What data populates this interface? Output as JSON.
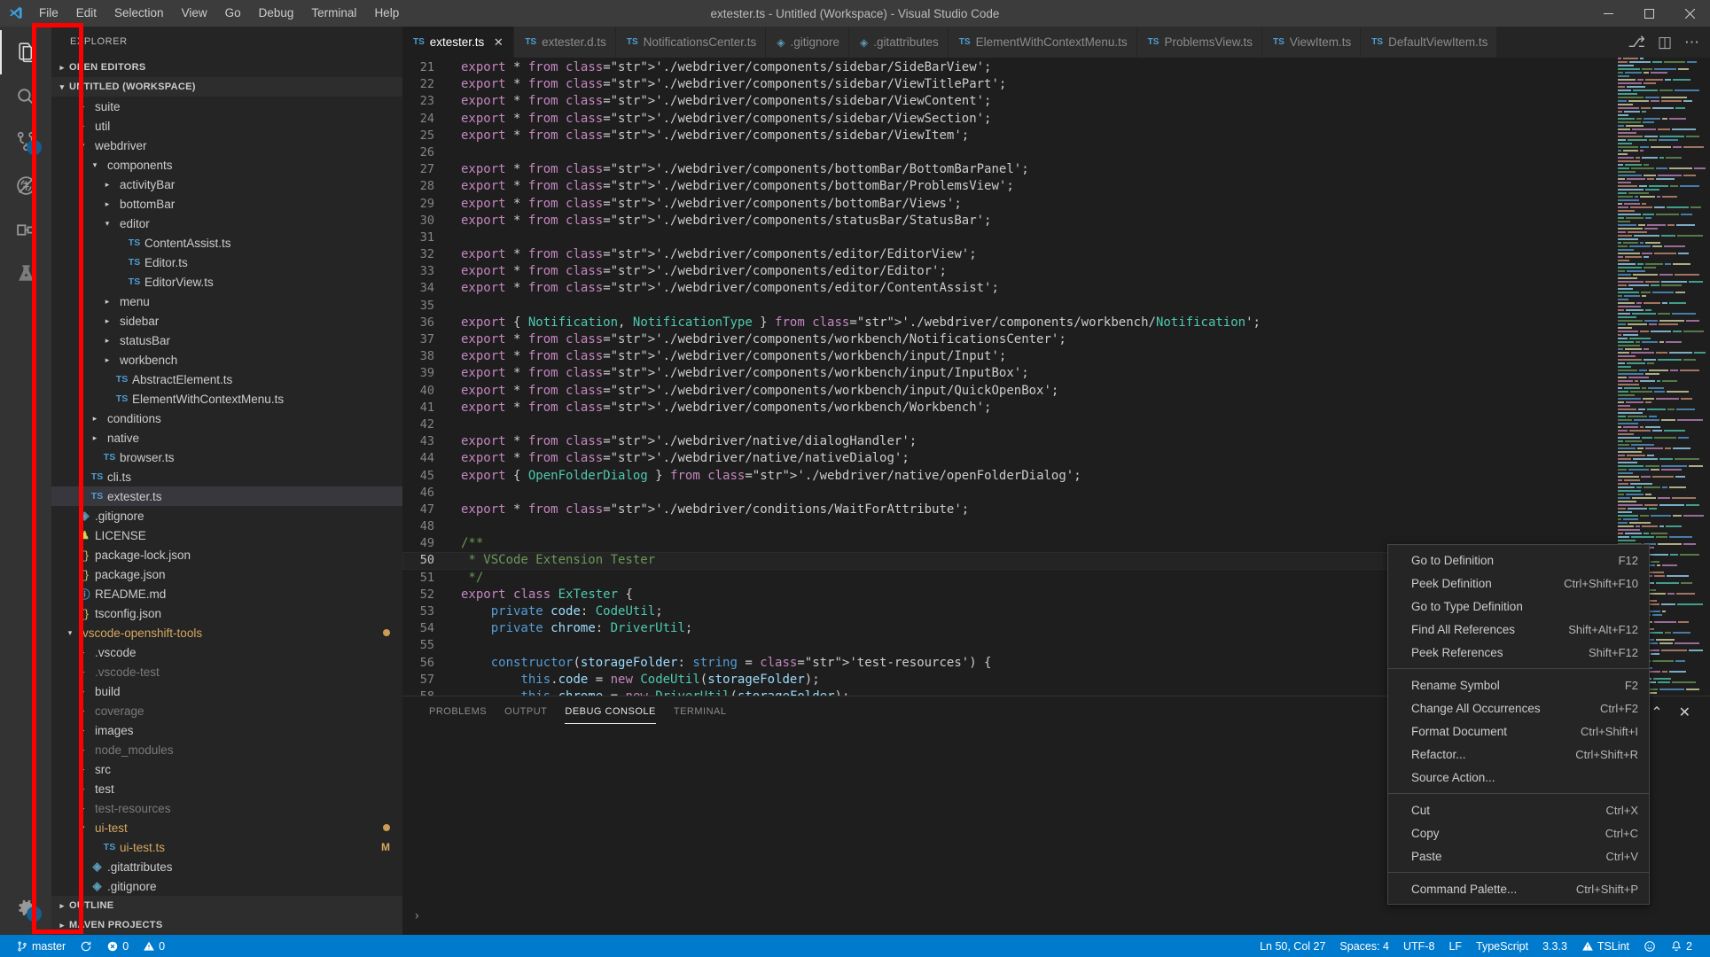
{
  "window": {
    "title": "extester.ts - Untitled (Workspace) - Visual Studio Code",
    "minimize_label": "─",
    "maximize_label": "❐",
    "close_label": "✕"
  },
  "menubar": {
    "items": [
      {
        "label": "File",
        "name": "menu-file"
      },
      {
        "label": "Edit",
        "name": "menu-edit"
      },
      {
        "label": "Selection",
        "name": "menu-selection"
      },
      {
        "label": "View",
        "name": "menu-view"
      },
      {
        "label": "Go",
        "name": "menu-go"
      },
      {
        "label": "Debug",
        "name": "menu-debug"
      },
      {
        "label": "Terminal",
        "name": "menu-terminal"
      },
      {
        "label": "Help",
        "name": "menu-help"
      }
    ]
  },
  "activitybar": {
    "highlight_color": "#ff0000",
    "items": [
      {
        "icon": "files-icon",
        "name": "activity-explorer",
        "active": true,
        "badge": ""
      },
      {
        "icon": "search-icon",
        "name": "activity-search",
        "active": false,
        "badge": ""
      },
      {
        "icon": "source-control-icon",
        "name": "activity-source-control",
        "active": false,
        "badge": "2"
      },
      {
        "icon": "debug-icon",
        "name": "activity-debug",
        "active": false,
        "badge": ""
      },
      {
        "icon": "extensions-icon",
        "name": "activity-extensions",
        "active": false,
        "badge": ""
      },
      {
        "icon": "beaker-icon",
        "name": "activity-test",
        "active": false,
        "badge": ""
      }
    ],
    "bottom": [
      {
        "icon": "gear-icon",
        "name": "activity-manage-settings",
        "badge": "1"
      }
    ]
  },
  "sidebar": {
    "title": "EXPLORER",
    "sections": [
      {
        "label": "OPEN EDITORS",
        "expanded": false
      },
      {
        "label": "UNTITLED (WORKSPACE)",
        "expanded": true
      }
    ],
    "footer_sections": [
      {
        "label": "OUTLINE",
        "expanded": false
      },
      {
        "label": "MAVEN PROJECTS",
        "expanded": false
      }
    ],
    "tree": [
      {
        "label": "suite",
        "indent": 1,
        "kind": "folder",
        "expanded": false,
        "state": ""
      },
      {
        "label": "util",
        "indent": 1,
        "kind": "folder",
        "expanded": false,
        "state": ""
      },
      {
        "label": "webdriver",
        "indent": 1,
        "kind": "folder",
        "expanded": true,
        "state": ""
      },
      {
        "label": "components",
        "indent": 2,
        "kind": "folder",
        "expanded": true,
        "state": ""
      },
      {
        "label": "activityBar",
        "indent": 3,
        "kind": "folder",
        "expanded": false,
        "state": ""
      },
      {
        "label": "bottomBar",
        "indent": 3,
        "kind": "folder",
        "expanded": false,
        "state": ""
      },
      {
        "label": "editor",
        "indent": 3,
        "kind": "folder",
        "expanded": true,
        "state": ""
      },
      {
        "label": "ContentAssist.ts",
        "indent": 4,
        "kind": "ts",
        "state": ""
      },
      {
        "label": "Editor.ts",
        "indent": 4,
        "kind": "ts",
        "state": ""
      },
      {
        "label": "EditorView.ts",
        "indent": 4,
        "kind": "ts",
        "state": ""
      },
      {
        "label": "menu",
        "indent": 3,
        "kind": "folder",
        "expanded": false,
        "state": ""
      },
      {
        "label": "sidebar",
        "indent": 3,
        "kind": "folder",
        "expanded": false,
        "state": ""
      },
      {
        "label": "statusBar",
        "indent": 3,
        "kind": "folder",
        "expanded": false,
        "state": ""
      },
      {
        "label": "workbench",
        "indent": 3,
        "kind": "folder",
        "expanded": false,
        "state": ""
      },
      {
        "label": "AbstractElement.ts",
        "indent": 3,
        "kind": "ts",
        "state": ""
      },
      {
        "label": "ElementWithContextMenu.ts",
        "indent": 3,
        "kind": "ts",
        "state": ""
      },
      {
        "label": "conditions",
        "indent": 2,
        "kind": "folder",
        "expanded": false,
        "state": ""
      },
      {
        "label": "native",
        "indent": 2,
        "kind": "folder",
        "expanded": false,
        "state": ""
      },
      {
        "label": "browser.ts",
        "indent": 2,
        "kind": "ts",
        "state": ""
      },
      {
        "label": "cli.ts",
        "indent": 1,
        "kind": "ts",
        "state": ""
      },
      {
        "label": "extester.ts",
        "indent": 1,
        "kind": "ts",
        "state": "selected"
      },
      {
        "label": ".gitignore",
        "indent": 0,
        "kind": "git",
        "state": ""
      },
      {
        "label": "LICENSE",
        "indent": 0,
        "kind": "lic",
        "state": ""
      },
      {
        "label": "package-lock.json",
        "indent": 0,
        "kind": "json",
        "state": ""
      },
      {
        "label": "package.json",
        "indent": 0,
        "kind": "json",
        "state": ""
      },
      {
        "label": "README.md",
        "indent": 0,
        "kind": "md",
        "state": ""
      },
      {
        "label": "tsconfig.json",
        "indent": 0,
        "kind": "json",
        "state": ""
      },
      {
        "label": "vscode-openshift-tools",
        "indent": 0,
        "kind": "folder",
        "expanded": true,
        "state": "modified",
        "dot": true
      },
      {
        "label": ".vscode",
        "indent": 1,
        "kind": "folder",
        "expanded": false,
        "state": ""
      },
      {
        "label": ".vscode-test",
        "indent": 1,
        "kind": "folder",
        "expanded": false,
        "state": "dim"
      },
      {
        "label": "build",
        "indent": 1,
        "kind": "folder",
        "expanded": false,
        "state": ""
      },
      {
        "label": "coverage",
        "indent": 1,
        "kind": "folder",
        "expanded": false,
        "state": "dim"
      },
      {
        "label": "images",
        "indent": 1,
        "kind": "folder",
        "expanded": false,
        "state": ""
      },
      {
        "label": "node_modules",
        "indent": 1,
        "kind": "folder",
        "expanded": false,
        "state": "dim"
      },
      {
        "label": "src",
        "indent": 1,
        "kind": "folder",
        "expanded": false,
        "state": ""
      },
      {
        "label": "test",
        "indent": 1,
        "kind": "folder",
        "expanded": false,
        "state": ""
      },
      {
        "label": "test-resources",
        "indent": 1,
        "kind": "folder",
        "expanded": false,
        "state": "dim"
      },
      {
        "label": "ui-test",
        "indent": 1,
        "kind": "folder",
        "expanded": true,
        "state": "modified",
        "dot": true
      },
      {
        "label": "ui-test.ts",
        "indent": 2,
        "kind": "ts",
        "state": "modified",
        "badge": "M"
      },
      {
        "label": ".gitattributes",
        "indent": 1,
        "kind": "git",
        "state": ""
      },
      {
        "label": ".gitignore",
        "indent": 1,
        "kind": "git",
        "state": ""
      }
    ]
  },
  "tabs": {
    "items": [
      {
        "label": "extester.ts",
        "icon": "ts",
        "active": true,
        "closable": true
      },
      {
        "label": "extester.d.ts",
        "icon": "ts",
        "active": false,
        "closable": false
      },
      {
        "label": "NotificationsCenter.ts",
        "icon": "ts",
        "active": false,
        "closable": false
      },
      {
        "label": ".gitignore",
        "icon": "git",
        "active": false,
        "closable": false
      },
      {
        "label": ".gitattributes",
        "icon": "git",
        "active": false,
        "closable": false
      },
      {
        "label": "ElementWithContextMenu.ts",
        "icon": "ts",
        "active": false,
        "closable": false
      },
      {
        "label": "ProblemsView.ts",
        "icon": "ts",
        "active": false,
        "closable": false
      },
      {
        "label": "ViewItem.ts",
        "icon": "ts",
        "active": false,
        "closable": false
      },
      {
        "label": "DefaultViewItem.ts",
        "icon": "ts",
        "active": false,
        "closable": false
      }
    ],
    "actions": [
      {
        "name": "run-and-debug-icon",
        "glyph": "⎇"
      },
      {
        "name": "split-editor-icon",
        "glyph": "◫"
      },
      {
        "name": "more-actions-icon",
        "glyph": "⋯"
      }
    ]
  },
  "editor": {
    "first_line_number": 21,
    "current_line": 50,
    "lines": [
      {
        "n": 21,
        "text": "export * from './webdriver/components/sidebar/SideBarView';"
      },
      {
        "n": 22,
        "text": "export * from './webdriver/components/sidebar/ViewTitlePart';"
      },
      {
        "n": 23,
        "text": "export * from './webdriver/components/sidebar/ViewContent';"
      },
      {
        "n": 24,
        "text": "export * from './webdriver/components/sidebar/ViewSection';"
      },
      {
        "n": 25,
        "text": "export * from './webdriver/components/sidebar/ViewItem';"
      },
      {
        "n": 26,
        "text": ""
      },
      {
        "n": 27,
        "text": "export * from './webdriver/components/bottomBar/BottomBarPanel';"
      },
      {
        "n": 28,
        "text": "export * from './webdriver/components/bottomBar/ProblemsView';"
      },
      {
        "n": 29,
        "text": "export * from './webdriver/components/bottomBar/Views';"
      },
      {
        "n": 30,
        "text": "export * from './webdriver/components/statusBar/StatusBar';"
      },
      {
        "n": 31,
        "text": ""
      },
      {
        "n": 32,
        "text": "export * from './webdriver/components/editor/EditorView';"
      },
      {
        "n": 33,
        "text": "export * from './webdriver/components/editor/Editor';"
      },
      {
        "n": 34,
        "text": "export * from './webdriver/components/editor/ContentAssist';"
      },
      {
        "n": 35,
        "text": ""
      },
      {
        "n": 36,
        "text": "export { Notification, NotificationType } from './webdriver/components/workbench/Notification';"
      },
      {
        "n": 37,
        "text": "export * from './webdriver/components/workbench/NotificationsCenter';"
      },
      {
        "n": 38,
        "text": "export * from './webdriver/components/workbench/input/Input';"
      },
      {
        "n": 39,
        "text": "export * from './webdriver/components/workbench/input/InputBox';"
      },
      {
        "n": 40,
        "text": "export * from './webdriver/components/workbench/input/QuickOpenBox';"
      },
      {
        "n": 41,
        "text": "export * from './webdriver/components/workbench/Workbench';"
      },
      {
        "n": 42,
        "text": ""
      },
      {
        "n": 43,
        "text": "export * from './webdriver/native/dialogHandler';"
      },
      {
        "n": 44,
        "text": "export * from './webdriver/native/nativeDialog';"
      },
      {
        "n": 45,
        "text": "export { OpenFolderDialog } from './webdriver/native/openFolderDialog';"
      },
      {
        "n": 46,
        "text": ""
      },
      {
        "n": 47,
        "text": "export * from './webdriver/conditions/WaitForAttribute';"
      },
      {
        "n": 48,
        "text": ""
      },
      {
        "n": 49,
        "text": "/**"
      },
      {
        "n": 50,
        "text": " * VSCode Extension Tester"
      },
      {
        "n": 51,
        "text": " */"
      },
      {
        "n": 52,
        "text": "export class ExTester {"
      },
      {
        "n": 53,
        "text": "    private code: CodeUtil;"
      },
      {
        "n": 54,
        "text": "    private chrome: DriverUtil;"
      },
      {
        "n": 55,
        "text": ""
      },
      {
        "n": 56,
        "text": "    constructor(storageFolder: string = 'test-resources') {"
      },
      {
        "n": 57,
        "text": "        this.code = new CodeUtil(storageFolder);"
      },
      {
        "n": 58,
        "text": "        this.chrome = new DriverUtil(storageFolder);"
      }
    ]
  },
  "panel": {
    "tabs": [
      {
        "label": "PROBLEMS",
        "active": false
      },
      {
        "label": "OUTPUT",
        "active": false
      },
      {
        "label": "DEBUG CONSOLE",
        "active": true
      },
      {
        "label": "TERMINAL",
        "active": false
      }
    ],
    "actions": [
      {
        "name": "maximize-panel-icon",
        "glyph": "⌃"
      },
      {
        "name": "close-panel-icon",
        "glyph": "✕"
      }
    ],
    "prompt": "›"
  },
  "context_menu": {
    "groups": [
      [
        {
          "label": "Go to Definition",
          "key": "F12"
        },
        {
          "label": "Peek Definition",
          "key": "Ctrl+Shift+F10"
        },
        {
          "label": "Go to Type Definition",
          "key": ""
        },
        {
          "label": "Find All References",
          "key": "Shift+Alt+F12"
        },
        {
          "label": "Peek References",
          "key": "Shift+F12"
        }
      ],
      [
        {
          "label": "Rename Symbol",
          "key": "F2"
        },
        {
          "label": "Change All Occurrences",
          "key": "Ctrl+F2"
        },
        {
          "label": "Format Document",
          "key": "Ctrl+Shift+I"
        },
        {
          "label": "Refactor...",
          "key": "Ctrl+Shift+R"
        },
        {
          "label": "Source Action...",
          "key": ""
        }
      ],
      [
        {
          "label": "Cut",
          "key": "Ctrl+X"
        },
        {
          "label": "Copy",
          "key": "Ctrl+C"
        },
        {
          "label": "Paste",
          "key": "Ctrl+V"
        }
      ],
      [
        {
          "label": "Command Palette...",
          "key": "Ctrl+Shift+P"
        }
      ]
    ]
  },
  "statusbar": {
    "background": "#007acc",
    "left": [
      {
        "name": "status-branch",
        "icon": "source-control-icon",
        "label": "master"
      },
      {
        "name": "status-sync",
        "icon": "sync-icon",
        "label": ""
      },
      {
        "name": "status-errors",
        "icon": "error-icon",
        "label": "0"
      },
      {
        "name": "status-warnings",
        "icon": "warning-icon",
        "label": "0"
      }
    ],
    "right": [
      {
        "name": "status-cursor-position",
        "icon": "",
        "label": "Ln 50, Col 27"
      },
      {
        "name": "status-indentation",
        "icon": "",
        "label": "Spaces: 4"
      },
      {
        "name": "status-encoding",
        "icon": "",
        "label": "UTF-8"
      },
      {
        "name": "status-eol",
        "icon": "",
        "label": "LF"
      },
      {
        "name": "status-language-mode",
        "icon": "",
        "label": "TypeScript"
      },
      {
        "name": "status-typescript-version",
        "icon": "",
        "label": "3.3.3"
      },
      {
        "name": "status-tslint",
        "icon": "warning-icon",
        "label": "TSLint"
      },
      {
        "name": "status-feedback",
        "icon": "smiley-icon",
        "label": ""
      },
      {
        "name": "status-notifications",
        "icon": "bell-icon",
        "label": "2"
      }
    ]
  }
}
